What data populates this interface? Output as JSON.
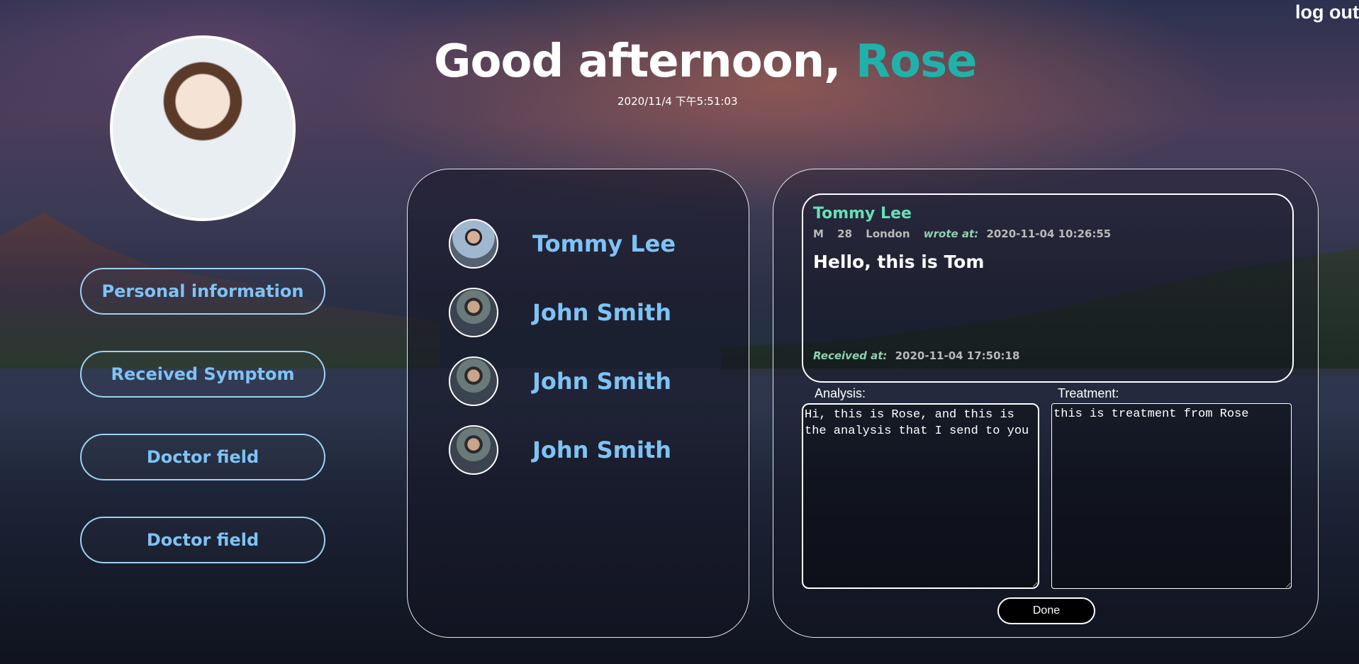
{
  "header": {
    "logout_label": "log out",
    "greeting_prefix": "Good afternoon, ",
    "user_name": "Rose",
    "datetime": "2020/11/4 下午5:51:03"
  },
  "sidebar": {
    "buttons": [
      {
        "label": "Personal information"
      },
      {
        "label": "Received Symptom"
      },
      {
        "label": "Doctor field"
      },
      {
        "label": "Doctor field"
      }
    ]
  },
  "patients": [
    {
      "name": "Tommy Lee"
    },
    {
      "name": "John Smith"
    },
    {
      "name": "John Smith"
    },
    {
      "name": "John Smith"
    }
  ],
  "message": {
    "sender": "Tommy Lee",
    "sex": "M",
    "age": "28",
    "city": "London",
    "wrote_label": "wrote at:",
    "wrote_at": "2020-11-04 10:26:55",
    "text": "Hello, this is Tom",
    "received_label": "Received at:",
    "received_at": "2020-11-04 17:50:18"
  },
  "form": {
    "analysis_label": "Analysis:",
    "analysis_value": "Hi, this is Rose, and this is the analysis that I send to you",
    "treatment_label": "Treatment:",
    "treatment_value": "this is treatment from Rose",
    "done_label": "Done"
  },
  "colors": {
    "accent_name": "#20b2aa",
    "link_blue": "#7ec3f5",
    "sender_green": "#66e0b8"
  }
}
